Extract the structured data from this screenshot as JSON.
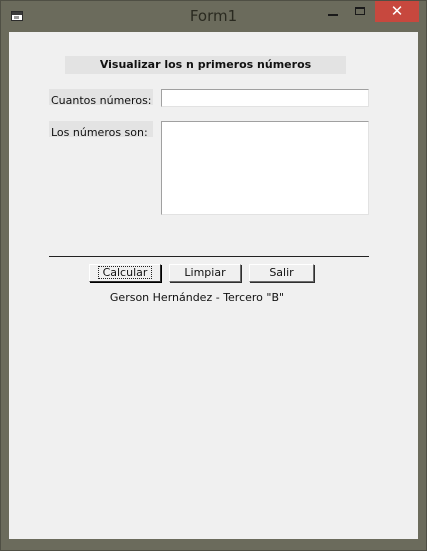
{
  "window": {
    "title": "Form1",
    "controls": {
      "minimize_icon": "minimize-icon",
      "maximize_icon": "maximize-icon",
      "close_glyph": "✕"
    },
    "colors": {
      "frame": "#6b6b5c",
      "close": "#c7483e",
      "client": "#f0f0f0"
    }
  },
  "form": {
    "heading": "Visualizar los n primeros números",
    "count_label": "Cuantos números:",
    "count_value": "",
    "result_label": "Los números son:",
    "result_value": ""
  },
  "buttons": {
    "calcular": "Calcular",
    "limpiar": "Limpiar",
    "salir": "Salir"
  },
  "credits": "Gerson Hernández - Tercero \"B\""
}
